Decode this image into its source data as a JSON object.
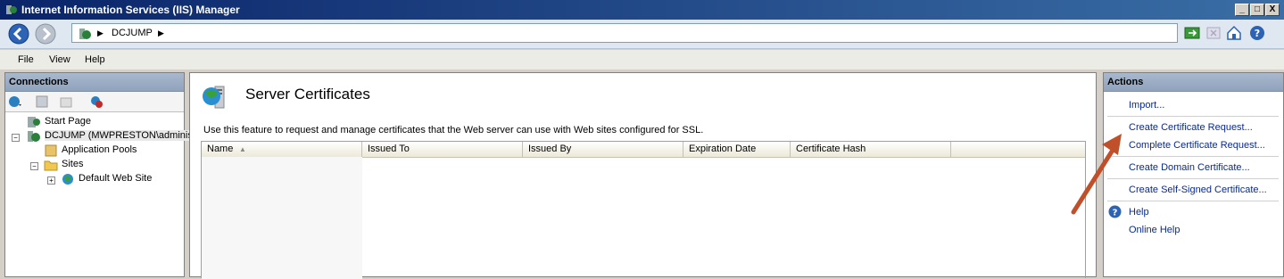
{
  "window": {
    "title": "Internet Information Services (IIS) Manager",
    "controls": [
      "_",
      "□",
      "X"
    ]
  },
  "address": {
    "crumbs": [
      "DCJUMP"
    ]
  },
  "menu": {
    "items": [
      "File",
      "View",
      "Help"
    ]
  },
  "connections": {
    "header": "Connections",
    "tree": [
      {
        "label": "Start Page"
      },
      {
        "label": "DCJUMP (MWPRESTON\\administr"
      },
      {
        "label": "Application Pools"
      },
      {
        "label": "Sites"
      },
      {
        "label": "Default Web Site"
      }
    ]
  },
  "main": {
    "title": "Server Certificates",
    "description": "Use this feature to request and manage certificates that the Web server can use with Web sites configured for SSL.",
    "columns": [
      "Name",
      "Issued To",
      "Issued By",
      "Expiration Date",
      "Certificate Hash"
    ],
    "sort_indicator": "▲"
  },
  "actions": {
    "header": "Actions",
    "items": [
      "Import...",
      "Create Certificate Request...",
      "Complete Certificate Request...",
      "Create Domain Certificate...",
      "Create Self-Signed Certificate...",
      "Help",
      "Online Help"
    ]
  },
  "colors": {
    "link": "#0b2a8a",
    "arrow": "#c0502a",
    "titlebar": "#0a246a"
  }
}
